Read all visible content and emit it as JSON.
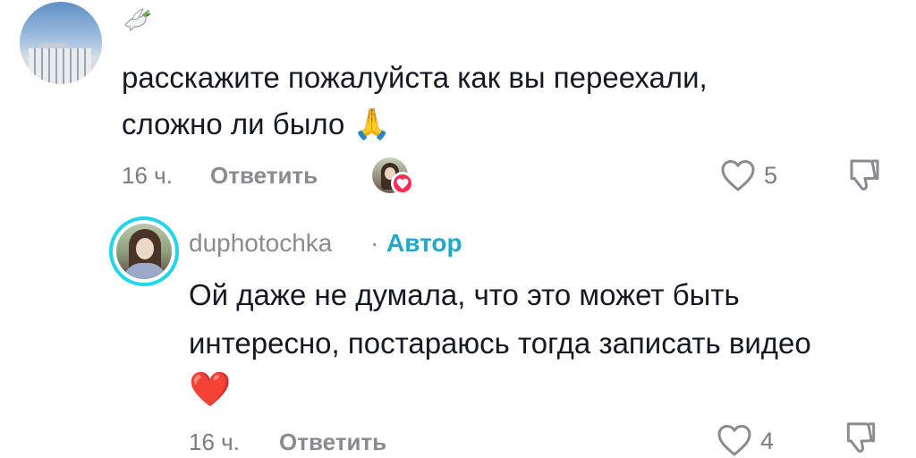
{
  "comments": [
    {
      "author_badge_icon": "dove-icon",
      "text_lines": [
        "расскажите пожалуйста как вы переехали,",
        "сложно ли было"
      ],
      "text_emoji": "🙏",
      "time": "16 ч.",
      "reply_label": "Ответить",
      "likes": "5",
      "liked_by_creator": true
    }
  ],
  "reply": {
    "username": "duphotochka",
    "separator": "·",
    "author_tag": "Автор",
    "text_lines": [
      "Ой даже не думала, что это может быть",
      "интересно, постараюсь тогда записать видео"
    ],
    "text_emoji": "❤️",
    "time": "16 ч.",
    "reply_label": "Ответить",
    "likes": "4"
  },
  "colors": {
    "text": "#161823",
    "meta": "#7c7d84",
    "author_tag": "#22a8c9",
    "avatar_ring": "#20d5ec",
    "like_badge": "#fe2c55"
  }
}
